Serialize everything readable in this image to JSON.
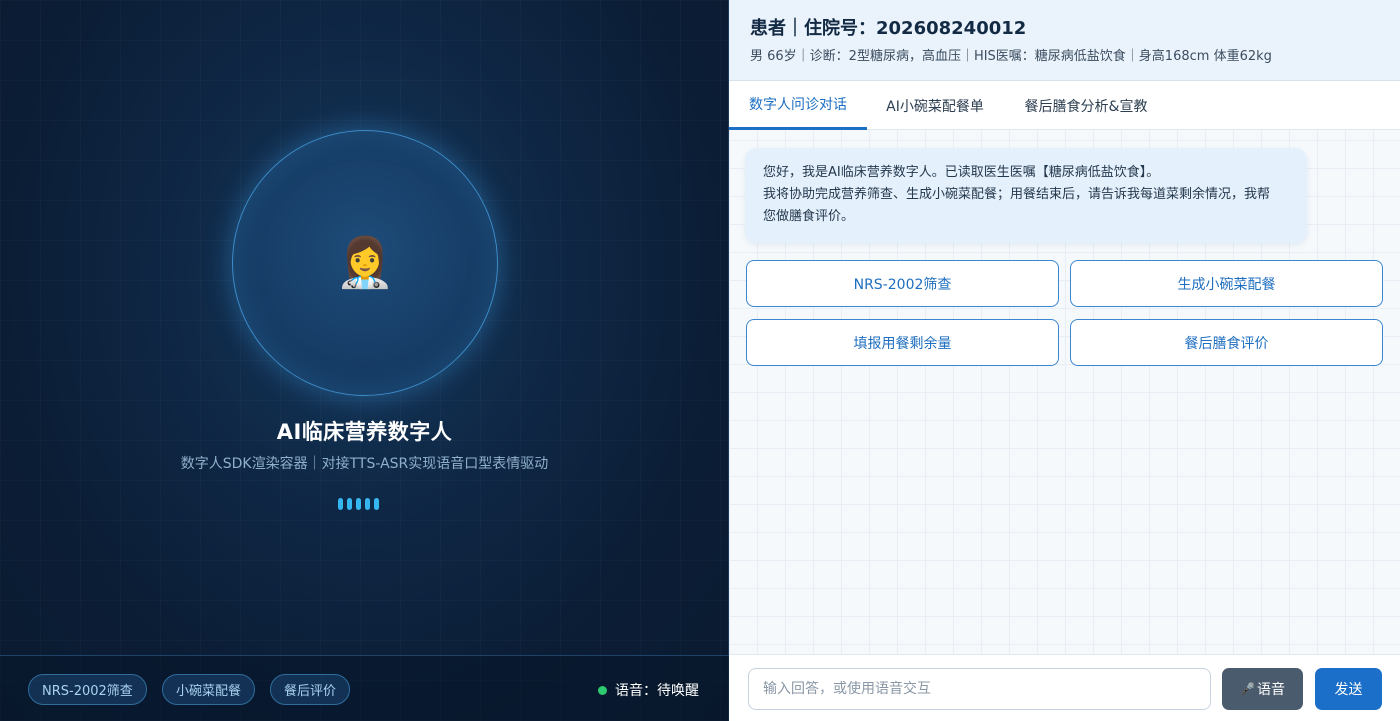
{
  "left": {
    "avatar_icon": "woman-health-worker-emoji",
    "avatar_glyph": "👩‍⚕️",
    "title": "AI临床营养数字人",
    "subtitle": "数字人SDK渲染容器｜对接TTS-ASR实现语音口型表情驱动",
    "chips": [
      "NRS-2002筛查",
      "小碗菜配餐",
      "餐后评价"
    ],
    "voice_status": "语音：待唤醒",
    "voice_status_color": "#2ecc71"
  },
  "patient": {
    "title": "患者｜住院号：202608240012",
    "info": "男 66岁｜诊断：2型糖尿病，高血压｜HIS医嘱：糖尿病低盐饮食｜身高168cm 体重62kg"
  },
  "tabs": [
    {
      "label": "数字人问诊对话",
      "active": true
    },
    {
      "label": "AI小碗菜配餐单",
      "active": false
    },
    {
      "label": "餐后膳食分析&宣教",
      "active": false
    }
  ],
  "chat": {
    "message_line1": "您好，我是AI临床营养数字人。已读取医生医嘱【糖尿病低盐饮食】。",
    "message_line2": "我将协助完成营养筛查、生成小碗菜配餐；用餐结束后，请告诉我每道菜剩余情况，我帮",
    "message_line3": "您做膳食评价。"
  },
  "actions": [
    "NRS-2002筛查",
    "生成小碗菜配餐",
    "填报用餐剩余量",
    "餐后膳食评价"
  ],
  "input": {
    "value": "",
    "placeholder": "输入回答，或使用语音交互",
    "voice_label": "语音",
    "voice_icon": "microphone-icon",
    "voice_glyph": "🎤",
    "send_label": "发送"
  },
  "colors": {
    "accent": "#1c6fc2",
    "left_bg": "#0f2846",
    "wave": "#35b6f0"
  }
}
